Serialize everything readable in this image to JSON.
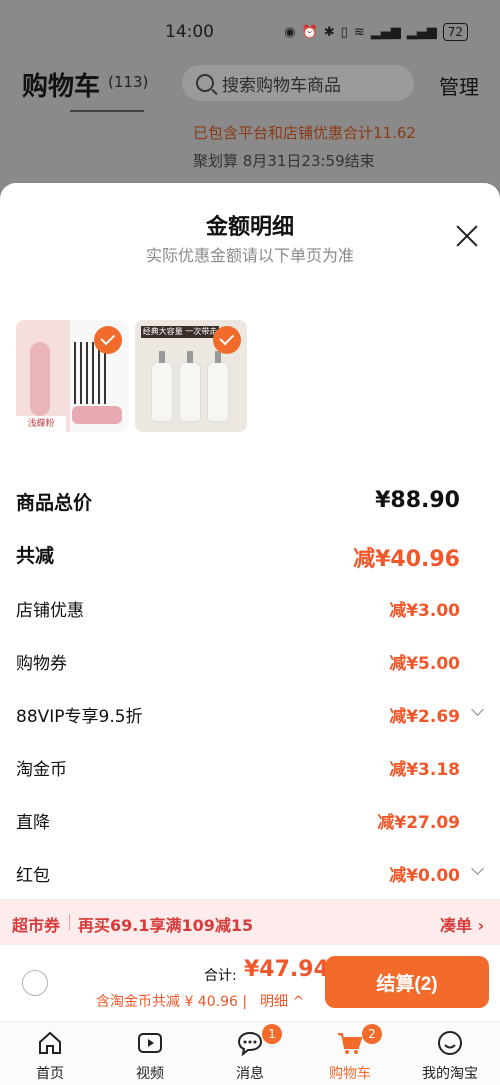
{
  "status_bar": {
    "time": "14:00",
    "battery": "72"
  },
  "background": {
    "cart_title": "购物车",
    "cart_count": "(113)",
    "search_placeholder": "搜索购物车商品",
    "manage": "管理",
    "promo_line1": "已包含平台和店铺优惠合计11.62",
    "promo_line2": "聚划算 8月31日23:59结束"
  },
  "sheet": {
    "title": "金额明细",
    "subtitle": "实际优惠金额请以下单页为准",
    "products": [
      {
        "tag": "浅蝶粉"
      },
      {
        "banner": "经典大容量 一次带走"
      }
    ],
    "rows": [
      {
        "label": "商品总价",
        "value": "¥88.90"
      },
      {
        "label": "共减",
        "value": "减¥40.96"
      },
      {
        "label": "店铺优惠",
        "value": "减¥3.00"
      },
      {
        "label": "购物券",
        "value": "减¥5.00"
      },
      {
        "label": "88VIP专享9.5折",
        "value": "减¥2.69"
      },
      {
        "label": "淘金币",
        "value": "减¥3.18"
      },
      {
        "label": "直降",
        "value": "减¥27.09"
      },
      {
        "label": "红包",
        "value": "减¥0.00"
      }
    ]
  },
  "coupon": {
    "tag": "超市券",
    "text": "再买69.1享满109减15",
    "action": "凑单"
  },
  "checkout": {
    "sum_label": "合计:",
    "sum_value": "¥47.94",
    "note": "含淘金币共减 ¥ 40.96 |",
    "detail": "明细 ^",
    "pay_label": "结算(2)"
  },
  "tabs": [
    {
      "label": "首页",
      "icon": "home-icon"
    },
    {
      "label": "视频",
      "icon": "video-icon"
    },
    {
      "label": "消息",
      "icon": "message-icon",
      "badge": "1"
    },
    {
      "label": "购物车",
      "icon": "cart-icon",
      "badge": "2"
    },
    {
      "label": "我的淘宝",
      "icon": "profile-icon"
    }
  ],
  "colors": {
    "accent": "#f36b2a",
    "discount": "#f0572b",
    "coupon_bg": "#fdeceb",
    "coupon_text": "#d63c3c"
  }
}
